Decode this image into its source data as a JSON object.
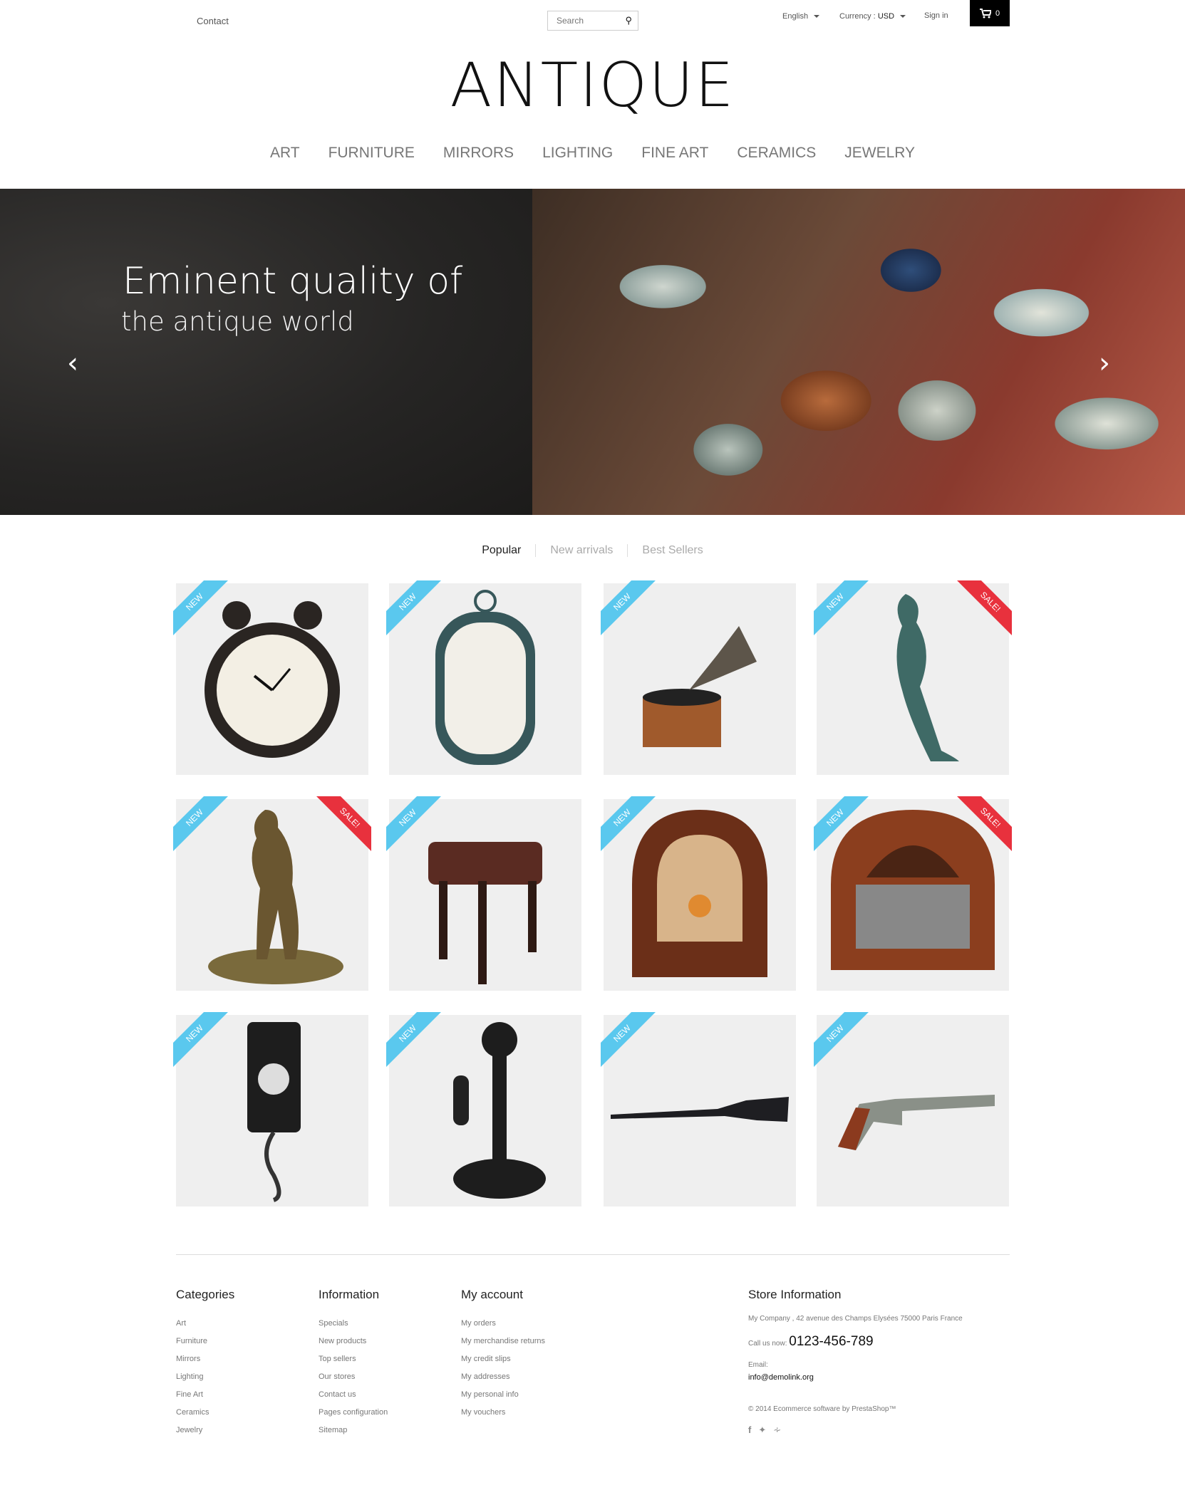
{
  "header": {
    "contact": "Contact",
    "search_placeholder": "Search",
    "language": "English",
    "currency_label": "Currency :",
    "currency_value": "USD",
    "sign_in": "Sign in",
    "cart_count": "0",
    "logo": "ANTIQUE"
  },
  "nav": [
    "ART",
    "FURNITURE",
    "MIRRORS",
    "LIGHTING",
    "FINE ART",
    "CERAMICS",
    "JEWELRY"
  ],
  "hero": {
    "title": "Eminent quality of",
    "subtitle": "the antique world"
  },
  "tabs": [
    "Popular",
    "New arrivals",
    "Best Sellers"
  ],
  "products": [
    {
      "item": "alarm-clock",
      "new": "NEW"
    },
    {
      "item": "wall-clock",
      "new": "NEW"
    },
    {
      "item": "gramophone",
      "new": "NEW"
    },
    {
      "item": "mermaid-statue",
      "new": "NEW",
      "sale": "SALE!"
    },
    {
      "item": "bronze-statue",
      "new": "NEW",
      "sale": "SALE!"
    },
    {
      "item": "piano-stool",
      "new": "NEW"
    },
    {
      "item": "cathedral-radio",
      "new": "NEW"
    },
    {
      "item": "wooden-radio",
      "new": "NEW",
      "sale": "SALE!"
    },
    {
      "item": "wall-telephone",
      "new": "NEW"
    },
    {
      "item": "candlestick-telephone",
      "new": "NEW"
    },
    {
      "item": "rifle",
      "new": "NEW"
    },
    {
      "item": "revolver",
      "new": "NEW"
    }
  ],
  "footer": {
    "categories": {
      "title": "Categories",
      "links": [
        "Art",
        "Furniture",
        "Mirrors",
        "Lighting",
        "Fine Art",
        "Ceramics",
        "Jewelry"
      ]
    },
    "information": {
      "title": "Information",
      "links": [
        "Specials",
        "New products",
        "Top sellers",
        "Our stores",
        "Contact us",
        "Pages configuration",
        "Sitemap"
      ]
    },
    "account": {
      "title": "My account",
      "links": [
        "My orders",
        "My merchandise returns",
        "My credit slips",
        "My addresses",
        "My personal info",
        "My vouchers"
      ]
    },
    "store": {
      "title": "Store Information",
      "address": "My Company , 42 avenue des Champs Elysées 75000 Paris France",
      "call_label": "Call us now:",
      "phone": "0123-456-789",
      "email_label": "Email:",
      "email": "info@demolink.org",
      "copyright": "© 2014 Ecommerce software by PrestaShop™"
    }
  },
  "colors": {
    "new_ribbon": "#5ac8ee",
    "sale_ribbon": "#e8313d",
    "cart_bg": "#000000"
  }
}
